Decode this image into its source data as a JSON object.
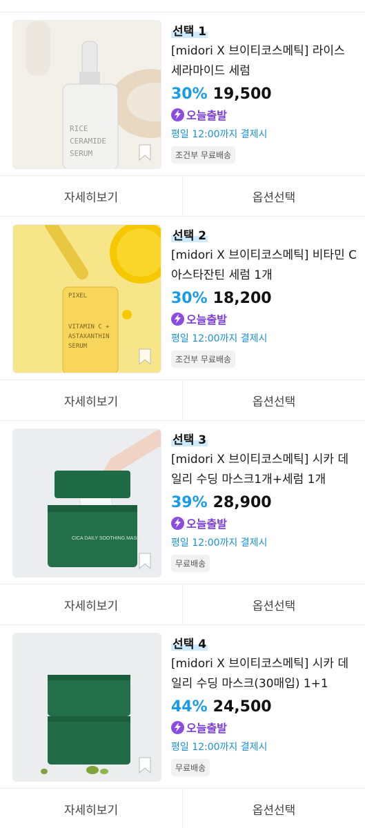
{
  "products": [
    {
      "tag": "선택 1",
      "title": "[midori X 브이티코스메틱] 라이스 세라마이드 세럼",
      "discount": "30%",
      "price": "19,500",
      "delivery_label": "오늘출발",
      "deadline": "평일 12:00까지 결제시",
      "shipping": "조건부 무료배송",
      "image_label": "RICE CERAMIDE SERUM",
      "detail_button": "자세히보기",
      "option_button": "옵션선택"
    },
    {
      "tag": "선택 2",
      "title": "[midori X 브이티코스메틱] 비타민 C 아스타잔틴 세럼 1개",
      "discount": "30%",
      "price": "18,200",
      "delivery_label": "오늘출발",
      "deadline": "평일 12:00까지 결제시",
      "shipping": "조건부 무료배송",
      "image_label": "VITAMIN C + ASTAXANTHIN SERUM",
      "detail_button": "자세히보기",
      "option_button": "옵션선택"
    },
    {
      "tag": "선택 3",
      "title": "[midori X 브이티코스메틱] 시카 데일리 수딩 마스크1개+세럼 1개",
      "discount": "39%",
      "price": "28,900",
      "delivery_label": "오늘출발",
      "deadline": "평일 12:00까지 결제시",
      "shipping": "무료배송",
      "detail_button": "자세히보기",
      "option_button": "옵션선택"
    },
    {
      "tag": "선택 4",
      "title": "[midori X 브이티코스메틱] 시카 데일리 수딩 마스크(30매입) 1+1",
      "discount": "44%",
      "price": "24,500",
      "delivery_label": "오늘출발",
      "deadline": "평일 12:00까지 결제시",
      "shipping": "무료배송",
      "detail_button": "자세히보기",
      "option_button": "옵션선택"
    }
  ],
  "colors": {
    "discount": "#1a9be8",
    "delivery": "#7a3cd6",
    "deadline": "#1a8fd8",
    "tag_highlight": "#cfeafc"
  },
  "icons": [
    "lightning-icon",
    "bookmark-icon"
  ]
}
